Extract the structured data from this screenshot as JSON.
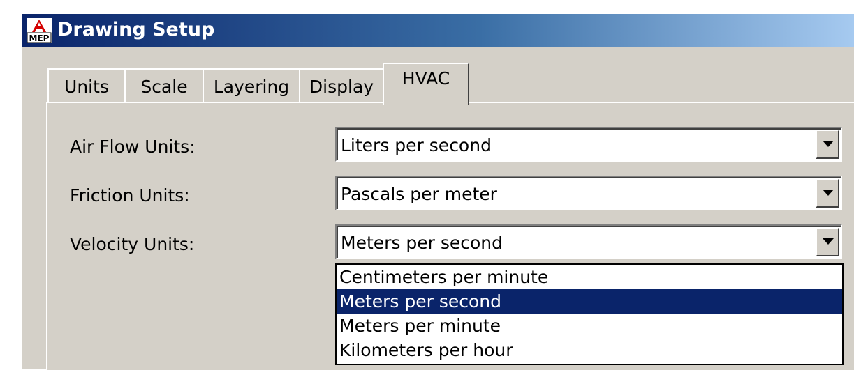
{
  "window": {
    "title": "Drawing Setup",
    "icon": "autocad-mep-icon",
    "icon_letter": "A",
    "icon_caption": "MEP"
  },
  "tabs": [
    {
      "label": "Units",
      "active": false
    },
    {
      "label": "Scale",
      "active": false
    },
    {
      "label": "Layering",
      "active": false
    },
    {
      "label": "Display",
      "active": false
    },
    {
      "label": "HVAC",
      "active": true
    }
  ],
  "fields": {
    "air_flow": {
      "label": "Air Flow Units:",
      "value": "Liters per second"
    },
    "friction": {
      "label": "Friction Units:",
      "value": "Pascals per meter"
    },
    "velocity": {
      "label": "Velocity Units:",
      "value": "Meters per second"
    }
  },
  "velocity_dropdown": {
    "options": [
      "Centimeters per minute",
      "Meters per second",
      "Meters per minute",
      "Kilometers per hour"
    ],
    "selected": "Meters per second"
  },
  "colors": {
    "selection_bg": "#0a246a",
    "face": "#d4d0c8"
  }
}
